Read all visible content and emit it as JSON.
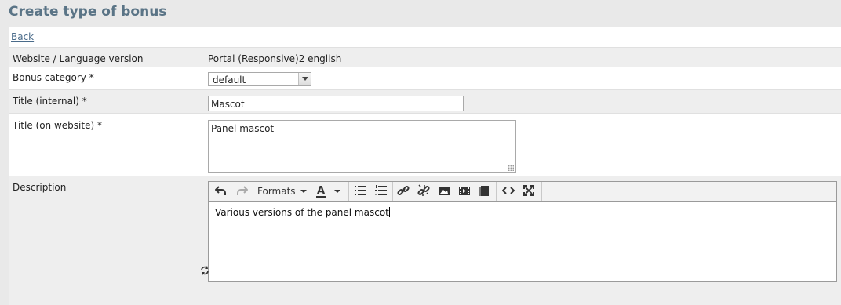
{
  "page": {
    "title": "Create type of bonus"
  },
  "nav": {
    "back_label": "Back"
  },
  "fields": {
    "website": {
      "label": "Website / Language version",
      "value": "Portal (Responsive)2 english"
    },
    "category": {
      "label": "Bonus category *",
      "value": "default"
    },
    "title_internal": {
      "label": "Title (internal) *",
      "value": "Mascot"
    },
    "title_website": {
      "label": "Title (on website) *",
      "value": "Panel mascot"
    },
    "description": {
      "label": "Description",
      "value": "Various versions of the panel mascot"
    }
  },
  "editor": {
    "formats_label": "Formats",
    "icons": [
      "undo-icon",
      "redo-icon",
      "text-color-icon",
      "bullet-list-icon",
      "numbered-list-icon",
      "link-icon",
      "unlink-icon",
      "image-icon",
      "media-icon",
      "template-icon",
      "code-icon",
      "fullscreen-icon"
    ]
  },
  "colors": {
    "title": "#5a7486",
    "link": "#4a6b8a",
    "page_bg": "#e9e9e9"
  }
}
